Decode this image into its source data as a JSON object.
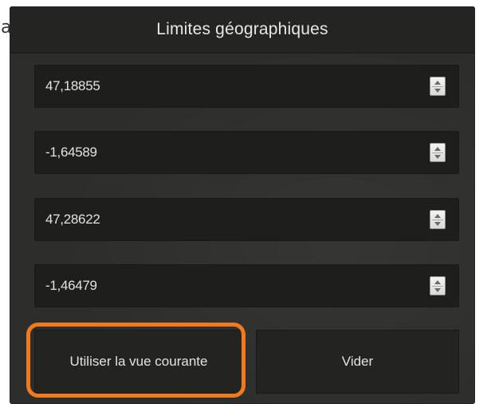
{
  "stray_text": "a",
  "panel": {
    "title": "Limites géographiques"
  },
  "fields": [
    {
      "value": "47,18855"
    },
    {
      "value": "-1,64589"
    },
    {
      "value": "47,28622"
    },
    {
      "value": "-1,46479"
    }
  ],
  "buttons": {
    "current_view_label": "Utiliser la vue courante",
    "clear_label": "Vider"
  },
  "colors": {
    "highlight": "#f07a1e",
    "panel_bg": "#2d2e2c",
    "field_bg": "#1e1f1d"
  },
  "icons": {
    "spinner": "spinner-up-down-icon"
  }
}
